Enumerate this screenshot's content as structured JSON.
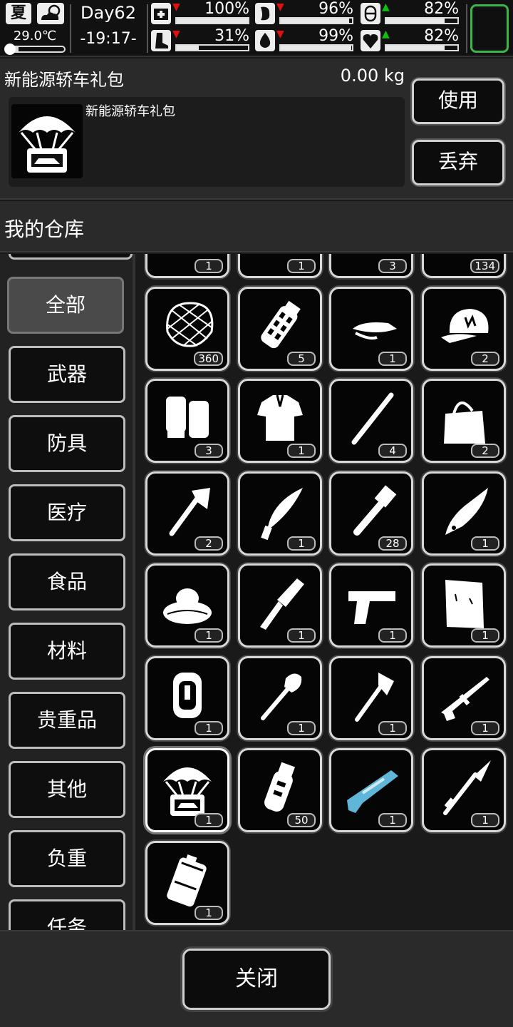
{
  "status": {
    "season": "夏",
    "weather_icon": "partly-cloudy-icon",
    "temperature": "29.0℃",
    "day": "Day62",
    "time": "-19:17-",
    "stats": [
      {
        "icon": "medkit-icon",
        "trend": "down",
        "value": "100%",
        "level": 1.0
      },
      {
        "icon": "stomach-icon",
        "trend": "down",
        "value": "96%",
        "level": 0.96
      },
      {
        "icon": "pill-icon",
        "trend": "up",
        "value": "82%",
        "level": 0.82
      },
      {
        "icon": "boot-icon",
        "trend": "down",
        "value": "31%",
        "level": 0.31
      },
      {
        "icon": "water-drop-icon",
        "trend": "down",
        "value": "99%",
        "level": 0.99
      },
      {
        "icon": "heart-icon",
        "trend": "up",
        "value": "82%",
        "level": 0.82
      }
    ]
  },
  "detail": {
    "name": "新能源轿车礼包",
    "weight": "0.00 kg",
    "description": "新能源轿车礼包",
    "icon": "airdrop-crate-icon",
    "use_label": "使用",
    "discard_label": "丢弃"
  },
  "storage": {
    "title": "我的仓库"
  },
  "categories": [
    {
      "label": "全部",
      "active": true
    },
    {
      "label": "武器",
      "active": false
    },
    {
      "label": "防具",
      "active": false
    },
    {
      "label": "医疗",
      "active": false
    },
    {
      "label": "食品",
      "active": false
    },
    {
      "label": "材料",
      "active": false
    },
    {
      "label": "贵重品",
      "active": false
    },
    {
      "label": "其他",
      "active": false
    },
    {
      "label": "负重",
      "active": false
    },
    {
      "label": "任务",
      "active": false
    }
  ],
  "items": [
    {
      "icon": "partial-item-icon",
      "count": "1"
    },
    {
      "icon": "partial-item-icon",
      "count": "1"
    },
    {
      "icon": "partial-item-icon",
      "count": "3"
    },
    {
      "icon": "partial-item-icon",
      "count": "134"
    },
    {
      "icon": "net-icon",
      "count": "360"
    },
    {
      "icon": "grenade-icon",
      "count": "5"
    },
    {
      "icon": "visor-cap-icon",
      "count": "1"
    },
    {
      "icon": "baseball-cap-icon",
      "count": "2"
    },
    {
      "icon": "gloves-icon",
      "count": "3"
    },
    {
      "icon": "shirt-icon",
      "count": "1"
    },
    {
      "icon": "stick-icon",
      "count": "4"
    },
    {
      "icon": "tote-bag-icon",
      "count": "2"
    },
    {
      "icon": "axe-icon",
      "count": "2"
    },
    {
      "icon": "kukri-icon",
      "count": "1"
    },
    {
      "icon": "pipe-wrench-icon",
      "count": "28"
    },
    {
      "icon": "knife-icon",
      "count": "1"
    },
    {
      "icon": "nest-icon",
      "count": "1"
    },
    {
      "icon": "multitool-icon",
      "count": "1"
    },
    {
      "icon": "pistol-icon",
      "count": "1"
    },
    {
      "icon": "cardboard-icon",
      "count": "1"
    },
    {
      "icon": "backpack-icon",
      "count": "1"
    },
    {
      "icon": "shovel-icon",
      "count": "1"
    },
    {
      "icon": "fire-axe-icon",
      "count": "1"
    },
    {
      "icon": "rifle-icon",
      "count": "1"
    },
    {
      "icon": "airdrop-crate-icon",
      "count": "1",
      "selected": true
    },
    {
      "icon": "flashbang-icon",
      "count": "50"
    },
    {
      "icon": "shotgun-icon",
      "count": "1"
    },
    {
      "icon": "spear-icon",
      "count": "1"
    },
    {
      "icon": "jerry-can-icon",
      "count": "1"
    }
  ],
  "footer": {
    "close_label": "关闭"
  },
  "colors": {
    "accent_green": "#39b54a",
    "stat_down": "#e01010",
    "stat_up": "#10c010"
  }
}
